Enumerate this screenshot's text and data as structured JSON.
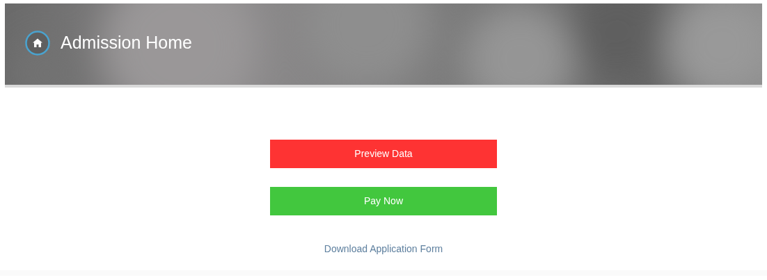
{
  "header": {
    "title": "Admission Home"
  },
  "buttons": [
    {
      "label": "Preview Data",
      "color": "#fe3333"
    },
    {
      "label": "Pay Now",
      "color": "#42c73e"
    }
  ],
  "link": "Download Application Form"
}
